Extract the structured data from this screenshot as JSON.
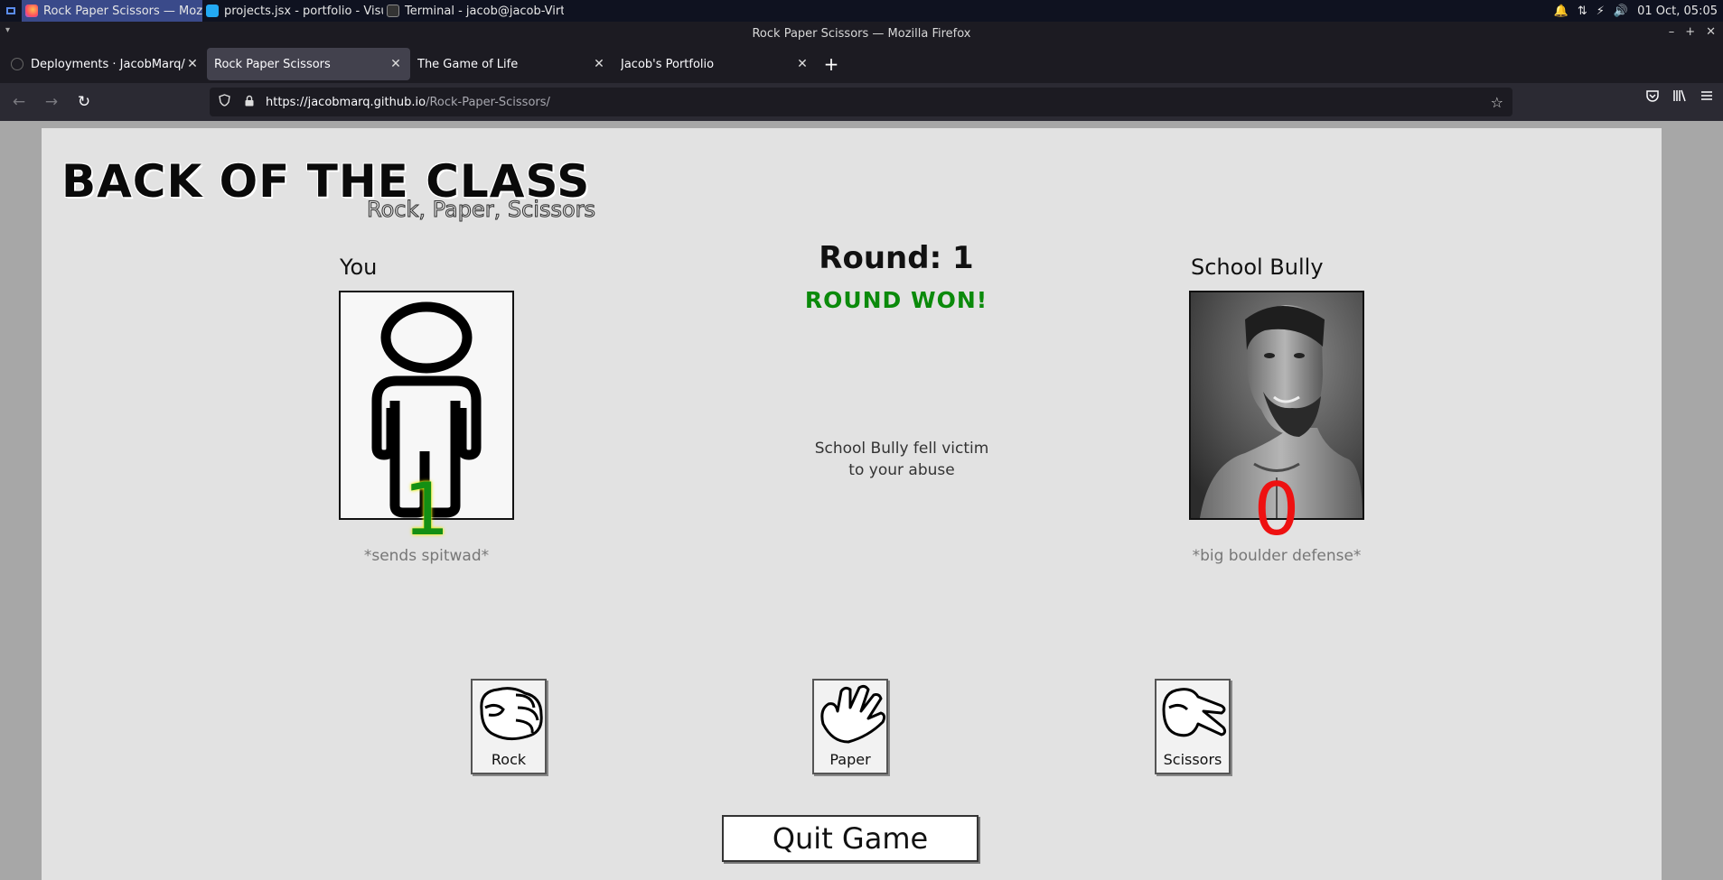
{
  "taskbar": {
    "tasks": [
      {
        "label": "Rock Paper Scissors — Mozil...",
        "active": true
      },
      {
        "label": "projects.jsx - portfolio - Visua...",
        "active": false
      },
      {
        "label": "Terminal - jacob@jacob-Virtu...",
        "active": false
      }
    ],
    "clock": "01 Oct, 05:05"
  },
  "window": {
    "title": "Rock Paper Scissors — Mozilla Firefox"
  },
  "tabs": [
    {
      "label": "Deployments · JacobMarq/Ro",
      "active": false
    },
    {
      "label": "Rock Paper Scissors",
      "active": true
    },
    {
      "label": "The Game of Life",
      "active": false
    },
    {
      "label": "Jacob's Portfolio",
      "active": false
    }
  ],
  "url": {
    "host": "https://jacobmarq.github.io",
    "path": "/Rock-Paper-Scissors/"
  },
  "game": {
    "title": "BACK OF THE CLASS",
    "subtitle": "Rock, Paper, Scissors",
    "player_name": "You",
    "opponent_name": "School Bully",
    "round_label": "Round: 1",
    "result": "ROUND WON!",
    "message_line1": "School Bully fell victim",
    "message_line2": "to your abuse",
    "player_score": "1",
    "opponent_score": "0",
    "player_action": "*sends spitwad*",
    "opponent_action": "*big boulder defense*",
    "choices": {
      "rock": "Rock",
      "paper": "Paper",
      "scissors": "Scissors"
    },
    "quit_label": "Quit Game"
  },
  "colors": {
    "result": "#0b8a0b",
    "player_score": "#138f13",
    "opponent_score": "#ee1111"
  }
}
